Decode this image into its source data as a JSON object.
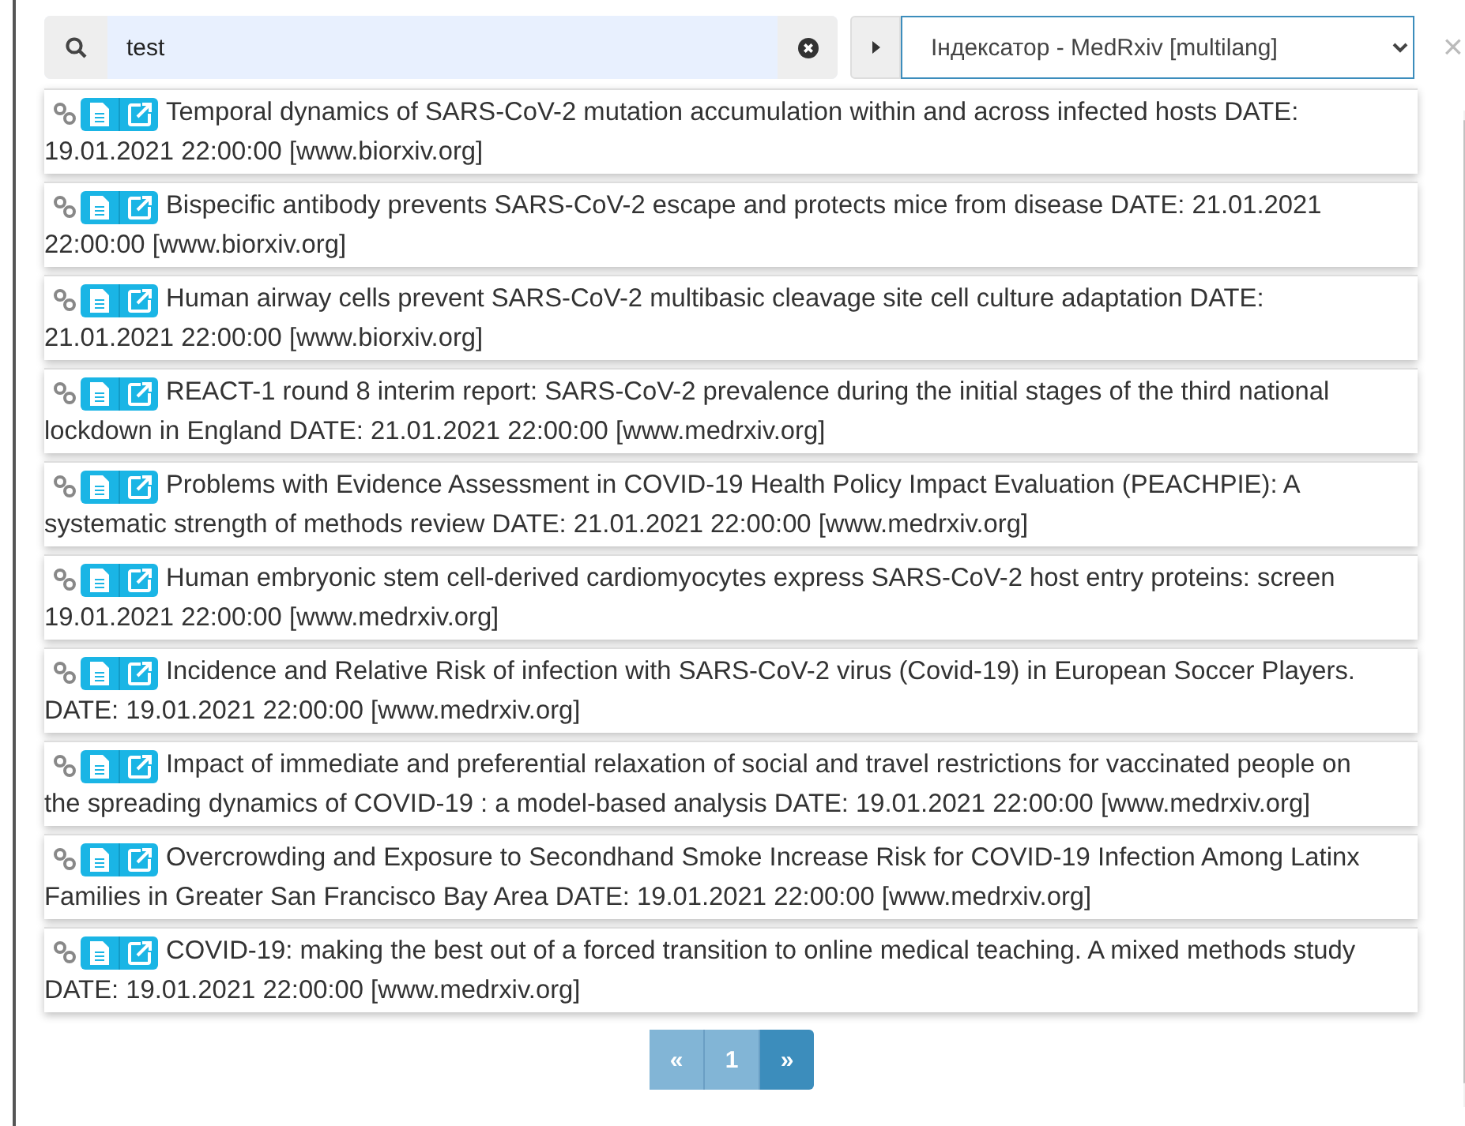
{
  "search": {
    "value": "test"
  },
  "indexer": {
    "value": "Індексатор - MedRxiv [multilang]"
  },
  "close": "×",
  "results": [
    {
      "text": "Temporal dynamics of SARS-CoV-2 mutation accumulation within and across infected hosts DATE: 19.01.2021 22:00:00 [www.biorxiv.org]"
    },
    {
      "text": "Bispecific antibody prevents SARS-CoV-2 escape and protects mice from disease DATE: 21.01.2021 22:00:00 [www.biorxiv.org]"
    },
    {
      "text": "Human airway cells prevent SARS-CoV-2 multibasic cleavage site cell culture adaptation DATE: 21.01.2021 22:00:00 [www.biorxiv.org]"
    },
    {
      "text": "REACT-1 round 8 interim report: SARS-CoV-2 prevalence during the initial stages of the third national lockdown in England DATE: 21.01.2021 22:00:00 [www.medrxiv.org]"
    },
    {
      "text": "Problems with Evidence Assessment in COVID-19 Health Policy Impact Evaluation (PEACHPIE): A systematic strength of methods review DATE: 21.01.2021 22:00:00 [www.medrxiv.org]"
    },
    {
      "text": "Human embryonic stem cell-derived cardiomyocytes express SARS-CoV-2 host entry proteins: screen 19.01.2021 22:00:00 [www.medrxiv.org]"
    },
    {
      "text": "Incidence and Relative Risk of infection with SARS-CoV-2 virus (Covid-19) in European Soccer Players. DATE: 19.01.2021 22:00:00 [www.medrxiv.org]"
    },
    {
      "text": "Impact of immediate and preferential relaxation of social and travel restrictions for vaccinated people on the spreading dynamics of COVID-19 : a model-based analysis DATE: 19.01.2021 22:00:00 [www.medrxiv.org]"
    },
    {
      "text": "Overcrowding and Exposure to Secondhand Smoke Increase Risk for COVID-19 Infection Among Latinx Families in Greater San Francisco Bay Area DATE: 19.01.2021 22:00:00 [www.medrxiv.org]"
    },
    {
      "text": "COVID-19: making the best out of a forced transition to online medical teaching. A mixed methods study DATE: 19.01.2021 22:00:00 [www.medrxiv.org]"
    }
  ],
  "pager": [
    {
      "label": "«",
      "disabled": true
    },
    {
      "label": "1",
      "disabled": true
    },
    {
      "label": "»",
      "disabled": false
    }
  ]
}
